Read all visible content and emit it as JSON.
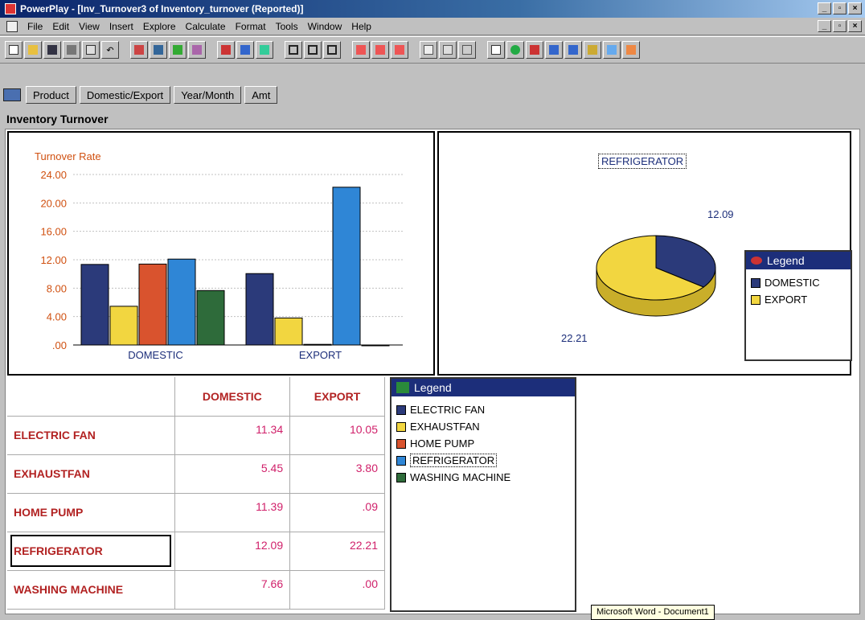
{
  "window": {
    "title": "PowerPlay - [Inv_Turnover3 of Inventory_turnover (Reported)]"
  },
  "menu": [
    "File",
    "Edit",
    "View",
    "Insert",
    "Explore",
    "Calculate",
    "Format",
    "Tools",
    "Window",
    "Help"
  ],
  "dimensions": [
    "Product",
    "Domestic/Export",
    "Year/Month",
    "Amt"
  ],
  "report_title": "Inventory Turnover",
  "colors": {
    "electric_fan": "#2b3a7a",
    "exhaustfan": "#f2d640",
    "home_pump": "#d9532e",
    "refrigerator": "#2f86d6",
    "washing_machine": "#2e6b3a"
  },
  "chart_data": [
    {
      "type": "bar",
      "ylabel": "Turnover Rate",
      "categories": [
        "DOMESTIC",
        "EXPORT"
      ],
      "ylim": [
        0,
        24
      ],
      "y_ticks": [
        "24.00",
        "20.00",
        "16.00",
        "12.00",
        "8.00",
        "4.00",
        ".00"
      ],
      "series": [
        {
          "name": "ELECTRIC FAN",
          "values": [
            11.34,
            10.05
          ]
        },
        {
          "name": "EXHAUSTFAN",
          "values": [
            5.45,
            3.8
          ]
        },
        {
          "name": "HOME PUMP",
          "values": [
            11.39,
            0.09
          ]
        },
        {
          "name": "REFRIGERATOR",
          "values": [
            12.09,
            22.21
          ]
        },
        {
          "name": "WASHING MACHINE",
          "values": [
            7.66,
            0.0
          ]
        }
      ]
    },
    {
      "type": "pie",
      "title": "REFRIGERATOR",
      "labels": [
        "DOMESTIC",
        "EXPORT"
      ],
      "values": [
        12.09,
        22.21
      ],
      "value_labels": [
        "12.09",
        "22.21"
      ]
    }
  ],
  "pie_legend": {
    "title": "Legend",
    "items": [
      "DOMESTIC",
      "EXPORT"
    ]
  },
  "legend": {
    "title": "Legend",
    "items": [
      "ELECTRIC FAN",
      "EXHAUSTFAN",
      "HOME PUMP",
      "REFRIGERATOR",
      "WASHING MACHINE"
    ]
  },
  "table": {
    "columns": [
      "DOMESTIC",
      "EXPORT"
    ],
    "rows": [
      {
        "label": "ELECTRIC FAN",
        "values": [
          "11.34",
          "10.05"
        ]
      },
      {
        "label": "EXHAUSTFAN",
        "values": [
          "5.45",
          "3.80"
        ]
      },
      {
        "label": "HOME PUMP",
        "values": [
          "11.39",
          ".09"
        ]
      },
      {
        "label": "REFRIGERATOR",
        "values": [
          "12.09",
          "22.21"
        ]
      },
      {
        "label": "WASHING MACHINE",
        "values": [
          "7.66",
          ".00"
        ]
      }
    ]
  },
  "tooltip": "Microsoft Word - Document1"
}
